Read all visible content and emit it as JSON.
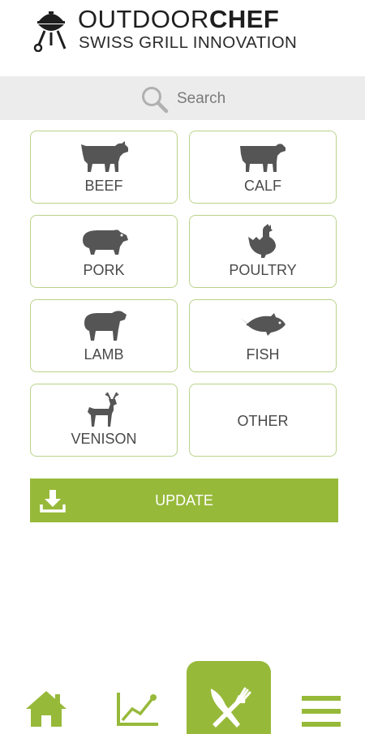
{
  "brand": {
    "name_light": "OUTDOOR",
    "name_bold": "CHEF",
    "tagline": "SWISS GRILL INNOVATION"
  },
  "search": {
    "label": "Search",
    "icon": "search-icon"
  },
  "categories": [
    {
      "label": "BEEF",
      "icon": "cow-icon"
    },
    {
      "label": "CALF",
      "icon": "calf-icon"
    },
    {
      "label": "PORK",
      "icon": "pig-icon"
    },
    {
      "label": "POULTRY",
      "icon": "chicken-icon"
    },
    {
      "label": "LAMB",
      "icon": "sheep-icon"
    },
    {
      "label": "FISH",
      "icon": "fish-icon"
    },
    {
      "label": "VENISON",
      "icon": "deer-icon"
    },
    {
      "label": "OTHER",
      "icon": ""
    }
  ],
  "update": {
    "label": "UPDATE",
    "icon": "download-icon"
  },
  "nav": [
    {
      "icon": "home-icon"
    },
    {
      "icon": "chart-icon"
    },
    {
      "icon": "fork-knife-icon",
      "active": true
    },
    {
      "icon": "menu-icon"
    }
  ],
  "colors": {
    "accent": "#97b93a",
    "tile_border": "#b9d38a",
    "icon_gray": "#555555",
    "search_bg": "#ececec"
  }
}
